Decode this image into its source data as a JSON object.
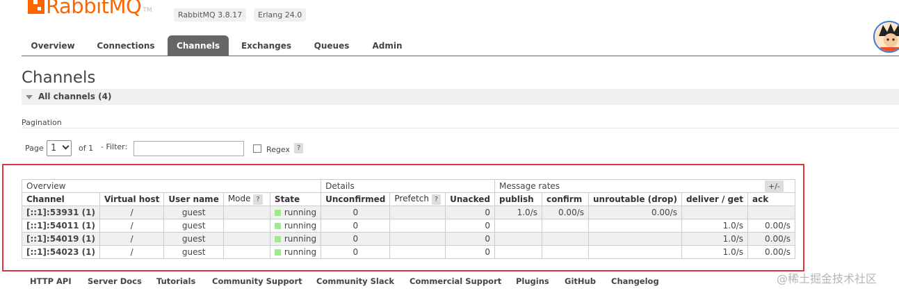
{
  "header": {
    "logo_text": "RabbitMQ",
    "logo_tm": "TM",
    "version": "RabbitMQ 3.8.17",
    "erlang": "Erlang 24.0"
  },
  "tabs": [
    {
      "label": "Overview"
    },
    {
      "label": "Connections"
    },
    {
      "label": "Channels",
      "active": true
    },
    {
      "label": "Exchanges"
    },
    {
      "label": "Queues"
    },
    {
      "label": "Admin"
    }
  ],
  "page_title": "Channels",
  "section_label": "All channels (4)",
  "pagination": {
    "label": "Pagination",
    "page_label": "Page",
    "page_value": "1",
    "of_label": "of 1",
    "filter_label": "- Filter:",
    "filter_value": "",
    "regex_label": "Regex",
    "help": "?"
  },
  "table": {
    "groups": {
      "overview": "Overview",
      "details": "Details",
      "rates": "Message rates"
    },
    "plus_minus": "+/-",
    "headers": [
      "Channel",
      "Virtual host",
      "User name",
      "Mode",
      "State",
      "Unconfirmed",
      "Prefetch",
      "Unacked",
      "publish",
      "confirm",
      "unroutable (drop)",
      "deliver / get",
      "ack"
    ],
    "rows": [
      {
        "channel": "[::1]:53931 (1)",
        "vhost": "/",
        "user": "guest",
        "mode": "",
        "state": "running",
        "unconfirmed": "0",
        "prefetch": "",
        "unacked": "0",
        "publish": "1.0/s",
        "confirm": "0.00/s",
        "unroutable": "0.00/s",
        "deliver": "",
        "ack": ""
      },
      {
        "channel": "[::1]:54011 (1)",
        "vhost": "/",
        "user": "guest",
        "mode": "",
        "state": "running",
        "unconfirmed": "0",
        "prefetch": "",
        "unacked": "0",
        "publish": "",
        "confirm": "",
        "unroutable": "",
        "deliver": "1.0/s",
        "ack": "0.00/s"
      },
      {
        "channel": "[::1]:54019 (1)",
        "vhost": "/",
        "user": "guest",
        "mode": "",
        "state": "running",
        "unconfirmed": "0",
        "prefetch": "",
        "unacked": "0",
        "publish": "",
        "confirm": "",
        "unroutable": "",
        "deliver": "1.0/s",
        "ack": "0.00/s"
      },
      {
        "channel": "[::1]:54023 (1)",
        "vhost": "/",
        "user": "guest",
        "mode": "",
        "state": "running",
        "unconfirmed": "0",
        "prefetch": "",
        "unacked": "0",
        "publish": "",
        "confirm": "",
        "unroutable": "",
        "deliver": "1.0/s",
        "ack": "0.00/s"
      }
    ]
  },
  "footer": [
    "HTTP API",
    "Server Docs",
    "Tutorials",
    "Community Support",
    "Community Slack",
    "Commercial Support",
    "Plugins",
    "GitHub",
    "Changelog"
  ],
  "watermark": "@稀土掘金技术社区",
  "colors": {
    "brand": "#ff6600",
    "active_tab": "#666666",
    "running": "#99ee88",
    "highlight": "#d9363e"
  }
}
